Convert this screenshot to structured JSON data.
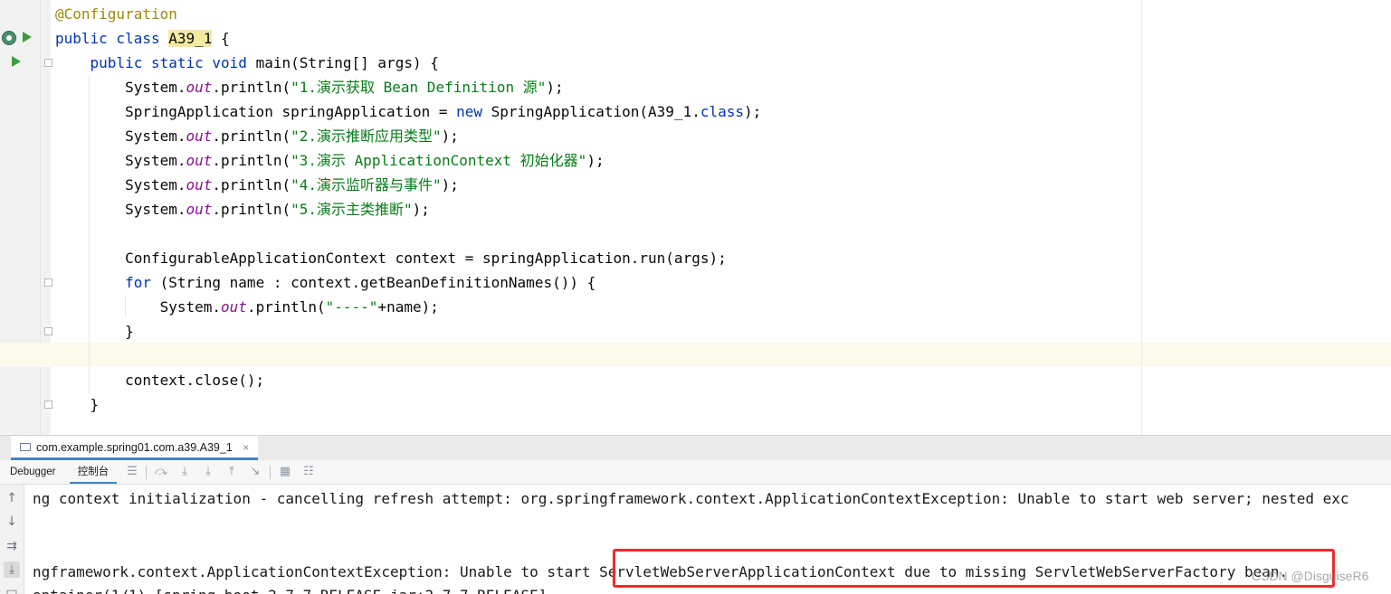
{
  "editor": {
    "lines": [
      {
        "parts": [
          {
            "t": "@Configuration",
            "c": "ann"
          }
        ]
      },
      {
        "parts": [
          {
            "t": "public class ",
            "c": "kw"
          },
          {
            "t": "A39_1",
            "c": "hl"
          },
          {
            "t": " {",
            "c": ""
          }
        ]
      },
      {
        "parts": [
          {
            "t": "    public static void ",
            "c": "kw"
          },
          {
            "t": "main(String[] args) {",
            "c": ""
          }
        ]
      },
      {
        "parts": [
          {
            "t": "        System.",
            "c": ""
          },
          {
            "t": "out",
            "c": "fld"
          },
          {
            "t": ".println(",
            "c": ""
          },
          {
            "t": "\"1.演示获取 Bean Definition 源\"",
            "c": "str"
          },
          {
            "t": ");",
            "c": ""
          }
        ]
      },
      {
        "parts": [
          {
            "t": "        SpringApplication springApplication = ",
            "c": ""
          },
          {
            "t": "new",
            "c": "kw"
          },
          {
            "t": " SpringApplication(A39_1.",
            "c": ""
          },
          {
            "t": "class",
            "c": "kw"
          },
          {
            "t": ");",
            "c": ""
          }
        ]
      },
      {
        "parts": [
          {
            "t": "        System.",
            "c": ""
          },
          {
            "t": "out",
            "c": "fld"
          },
          {
            "t": ".println(",
            "c": ""
          },
          {
            "t": "\"2.演示推断应用类型\"",
            "c": "str"
          },
          {
            "t": ");",
            "c": ""
          }
        ]
      },
      {
        "parts": [
          {
            "t": "        System.",
            "c": ""
          },
          {
            "t": "out",
            "c": "fld"
          },
          {
            "t": ".println(",
            "c": ""
          },
          {
            "t": "\"3.演示 ApplicationContext 初始化器\"",
            "c": "str"
          },
          {
            "t": ");",
            "c": ""
          }
        ]
      },
      {
        "parts": [
          {
            "t": "        System.",
            "c": ""
          },
          {
            "t": "out",
            "c": "fld"
          },
          {
            "t": ".println(",
            "c": ""
          },
          {
            "t": "\"4.演示监听器与事件\"",
            "c": "str"
          },
          {
            "t": ");",
            "c": ""
          }
        ]
      },
      {
        "parts": [
          {
            "t": "        System.",
            "c": ""
          },
          {
            "t": "out",
            "c": "fld"
          },
          {
            "t": ".println(",
            "c": ""
          },
          {
            "t": "\"5.演示主类推断\"",
            "c": "str"
          },
          {
            "t": ");",
            "c": ""
          }
        ]
      },
      {
        "parts": []
      },
      {
        "parts": [
          {
            "t": "        ConfigurableApplicationContext context = springApplication.run(args);",
            "c": ""
          }
        ]
      },
      {
        "parts": [
          {
            "t": "        ",
            "c": ""
          },
          {
            "t": "for",
            "c": "kw"
          },
          {
            "t": " (String name : context.getBeanDefinitionNames()) {",
            "c": ""
          }
        ]
      },
      {
        "parts": [
          {
            "t": "            System.",
            "c": ""
          },
          {
            "t": "out",
            "c": "fld"
          },
          {
            "t": ".println(",
            "c": ""
          },
          {
            "t": "\"----\"",
            "c": "str"
          },
          {
            "t": "+name);",
            "c": ""
          }
        ]
      },
      {
        "parts": [
          {
            "t": "        }",
            "c": ""
          }
        ]
      },
      {
        "parts": []
      },
      {
        "parts": [
          {
            "t": "        context.close();",
            "c": ""
          }
        ]
      },
      {
        "parts": [
          {
            "t": "    }",
            "c": ""
          }
        ]
      }
    ]
  },
  "run_panel": {
    "tab_label": "com.example.spring01.com.a39.A39_1",
    "tab_close": "×",
    "toolbar": {
      "debugger_label": "Debugger",
      "console_label": "控制台"
    },
    "console_lines": [
      "ng context initialization - cancelling refresh attempt: org.springframework.context.ApplicationContextException: Unable to start web server; nested exc",
      "",
      "",
      "ngframework.context.ApplicationContextException: Unable to start ServletWebServerApplicationContext due to missing ServletWebServerFactory bean.",
      "ontainer(1/1) [spring-boot-2.7.7.RELEASE.jar:2.7.7.RELEASE]"
    ]
  },
  "watermark": "CSDN @DisguiseR6",
  "colors": {
    "keyword": "#0033b3",
    "annotation": "#9e880d",
    "string": "#067d17",
    "field": "#871094",
    "highlight_box": "#ee2b2b",
    "tab_accent": "#4083c9"
  }
}
